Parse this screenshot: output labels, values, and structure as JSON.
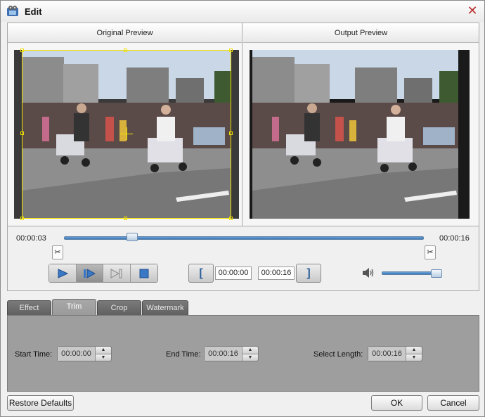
{
  "window": {
    "title": "Edit"
  },
  "preview": {
    "original_label": "Original Preview",
    "output_label": "Output Preview"
  },
  "timeline": {
    "current_time": "00:00:03",
    "total_time": "00:00:16",
    "position_fraction": 0.19
  },
  "playback": {
    "buttons": [
      "play-icon",
      "play-frame-icon",
      "next-frame-icon",
      "stop-icon"
    ]
  },
  "trim_bar": {
    "start_bracket": "[",
    "start_value": "00:00:00",
    "end_value": "00:00:16",
    "end_bracket": "]"
  },
  "volume": {
    "level_fraction": 0.95
  },
  "tabs": [
    {
      "label": "Effect",
      "active": false
    },
    {
      "label": "Trim",
      "active": true
    },
    {
      "label": "Crop",
      "active": false
    },
    {
      "label": "Watermark",
      "active": false
    }
  ],
  "trim": {
    "start_label": "Start Time:",
    "start_value": "00:00:00",
    "end_label": "End Time:",
    "end_value": "00:00:16",
    "length_label": "Select Length:",
    "length_value": "00:00:16"
  },
  "footer": {
    "restore_label": "Restore Defaults",
    "ok_label": "OK",
    "cancel_label": "Cancel"
  }
}
